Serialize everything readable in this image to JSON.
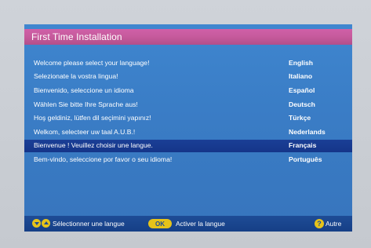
{
  "header": {
    "title": "First Time Installation"
  },
  "languages": [
    {
      "prompt": "Welcome please select your language!",
      "lang": "English"
    },
    {
      "prompt": "Selezionate la vostra lingua!",
      "lang": "Italiano"
    },
    {
      "prompt": "Bienvenido, seleccione un idioma",
      "lang": "Español"
    },
    {
      "prompt": "Wählen Sie bitte Ihre Sprache aus!",
      "lang": "Deutsch"
    },
    {
      "prompt": "Hoş geldiniz, lütfen dil seçimini yapınız!",
      "lang": "Türkçe"
    },
    {
      "prompt": "Welkom, selecteer uw taal A.U.B.!",
      "lang": "Nederlands"
    },
    {
      "prompt": "Bienvenue ! Veuillez choisir une langue.",
      "lang": "Français"
    },
    {
      "prompt": "Bem-vindo, seleccione por favor o seu idioma!",
      "lang": "Português"
    }
  ],
  "selected_language": "Français",
  "footer": {
    "select_label": "Sélectionner une langue",
    "ok_key": "OK",
    "activate_label": "Activer la langue",
    "help_key": "?",
    "help_label": "Autre"
  },
  "colors": {
    "panel_blue": "#3a7dc6",
    "title_magenta": "#c65a9c",
    "selection_navy": "#153589",
    "footer_navy": "#163f86",
    "key_yellow": "#e6c31a"
  },
  "icons": {
    "down_key": "arrow-down-icon",
    "up_key": "arrow-up-icon",
    "ok_key": "ok-key-icon",
    "help_key": "help-key-icon"
  }
}
